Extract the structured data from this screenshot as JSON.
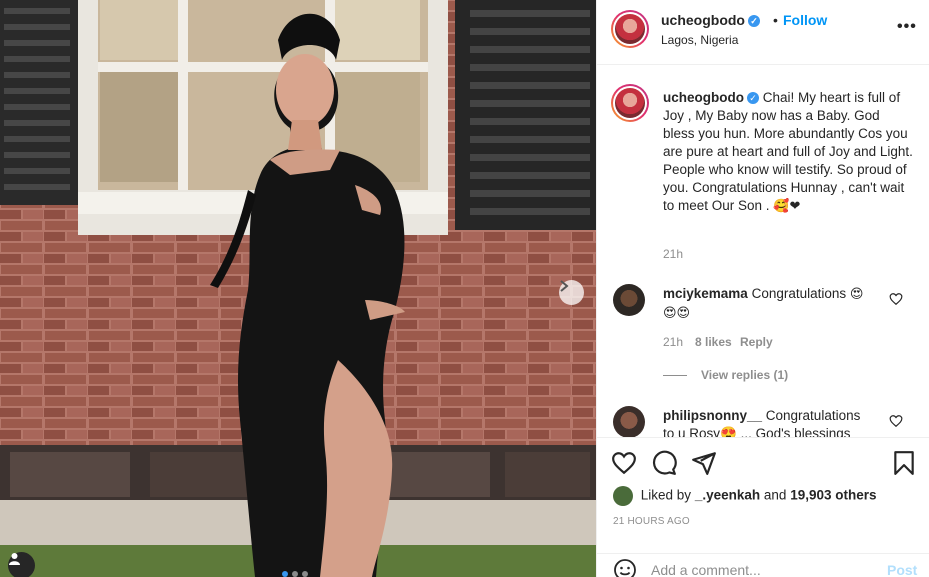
{
  "post": {
    "username": "ucheogbodo",
    "follow_label": "Follow",
    "separator": "•",
    "location": "Lagos, Nigeria",
    "more_label": "•••"
  },
  "caption": {
    "username": "ucheogbodo",
    "text": "Chai! My heart is full of Joy , My Baby now has a Baby. God bless you hun. More abundantly Cos you are pure at heart and full of Joy and Light. People who know will testify. So proud of you. Congratulations Hunnay , can't wait to meet Our Son .",
    "emojis": "🥰❤",
    "time": "21h"
  },
  "comments": [
    {
      "username": "mciykemama",
      "text": "Congratulations",
      "emojis": "😍",
      "emojis_line2": "😍😍",
      "time": "21h",
      "likes": "8 likes",
      "reply_label": "Reply",
      "view_replies": "View replies (1)"
    },
    {
      "username": "philipsnonny__",
      "text": "Congratulations",
      "text_line2": "to u Rosy😍 ... God's blessings"
    }
  ],
  "likes": {
    "prefix": "Liked by",
    "user": "_.yeenkah",
    "mid": "and",
    "count": "19,903 others"
  },
  "timestamp": "21 HOURS AGO",
  "add_comment": {
    "placeholder": "Add a comment...",
    "post_label": "Post"
  },
  "colors": {
    "link_blue": "#0095f6",
    "post_disabled": "#b2dffc",
    "muted": "#8e8e8e"
  },
  "icons": [
    "chevron-right-icon",
    "user-tag-icon",
    "heart-icon",
    "comment-icon",
    "share-icon",
    "bookmark-icon",
    "smile-icon",
    "verified-icon"
  ]
}
